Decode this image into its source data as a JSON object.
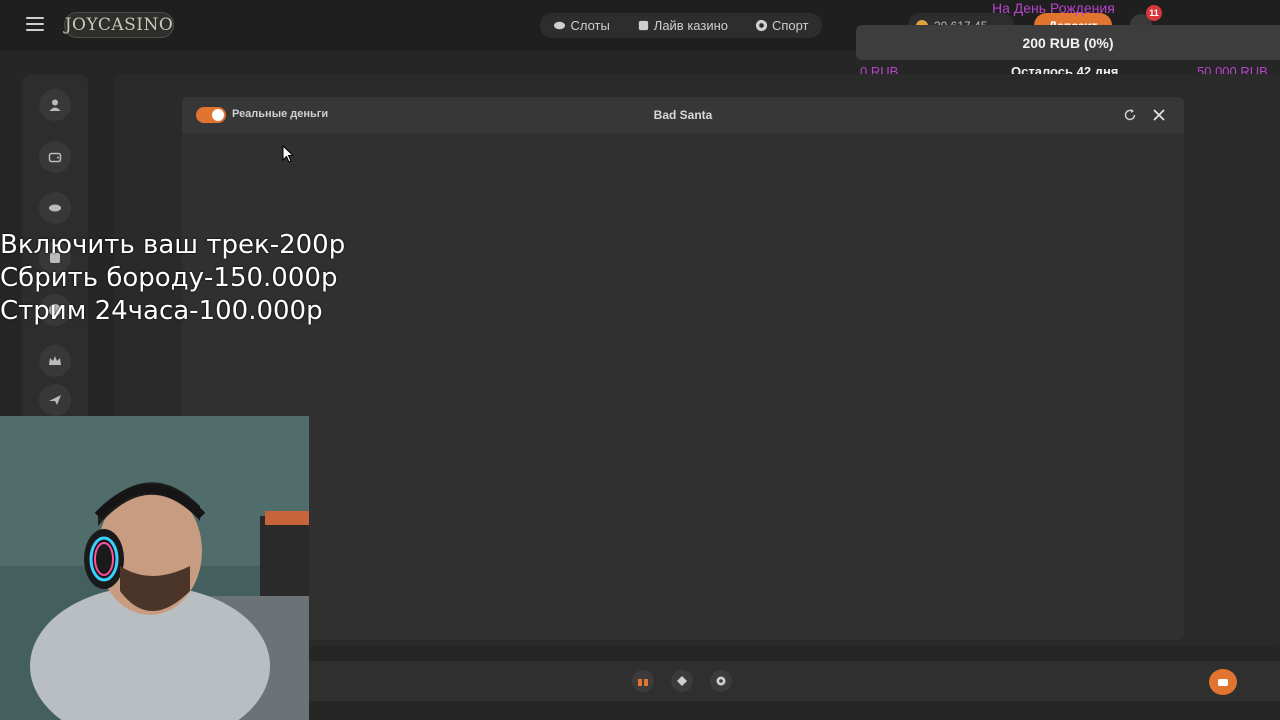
{
  "header": {
    "logo": "JOYCASINO",
    "nav": [
      {
        "label": "Слоты",
        "icon": "slots-icon"
      },
      {
        "label": "Лайв казино",
        "icon": "live-casino-icon"
      },
      {
        "label": "Спорт",
        "icon": "sport-ball-icon"
      }
    ],
    "balance": "30 617.45",
    "deposit_label": "Депозит",
    "notification_count": "11"
  },
  "donation_goal": {
    "title": "На День Рождения",
    "progress_text": "200 RUB (0%)",
    "progress": 0,
    "min_label": "0 RUB",
    "remaining": "Осталось 42 дня",
    "max_label": "50 000 RUB"
  },
  "sidebar": {
    "icons": [
      "user-icon",
      "wallet-icon",
      "slots-icon",
      "live-casino-icon",
      "sport-ball-icon",
      "crown-icon",
      "aviator-plane-icon"
    ]
  },
  "game": {
    "mode_label": "Реальные деньги",
    "mode_on": true,
    "title": "Bad Santa"
  },
  "overlay": {
    "lines": [
      "Включить ваш трек-200р",
      "Сбрить бороду-150.000р",
      "Стрим 24часа-100.000р"
    ]
  },
  "footer": {
    "icons": [
      "gift-icon",
      "ticket-icon",
      "settings-icon",
      "chat-icon"
    ]
  },
  "colors": {
    "accent": "#e1742f",
    "goal_text": "#b646c8",
    "background": "#262626"
  }
}
